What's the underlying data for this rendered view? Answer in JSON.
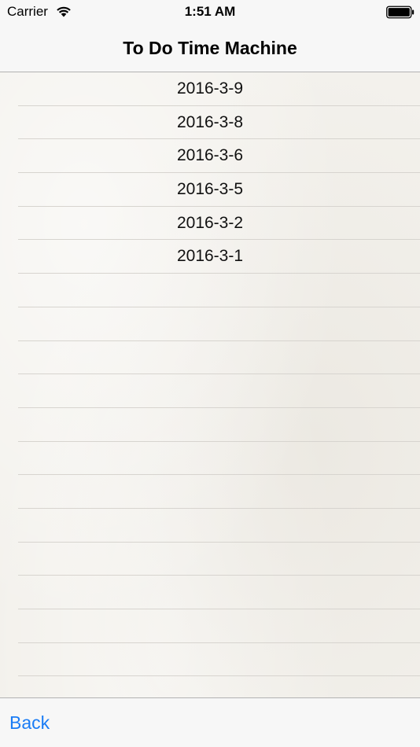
{
  "status_bar": {
    "carrier": "Carrier",
    "time": "1:51 AM",
    "icons": [
      "wifi-icon",
      "battery-icon"
    ]
  },
  "nav_bar": {
    "title": "To Do Time Machine"
  },
  "list": {
    "items": [
      {
        "label": "2016-3-9"
      },
      {
        "label": "2016-3-8"
      },
      {
        "label": "2016-3-6"
      },
      {
        "label": "2016-3-5"
      },
      {
        "label": "2016-3-2"
      },
      {
        "label": "2016-3-1"
      }
    ]
  },
  "toolbar": {
    "back_label": "Back"
  },
  "colors": {
    "accent": "#1a7cf5",
    "paper": "#f3f1ec",
    "separator": "#d7d4cf",
    "bar": "#f7f7f7"
  }
}
